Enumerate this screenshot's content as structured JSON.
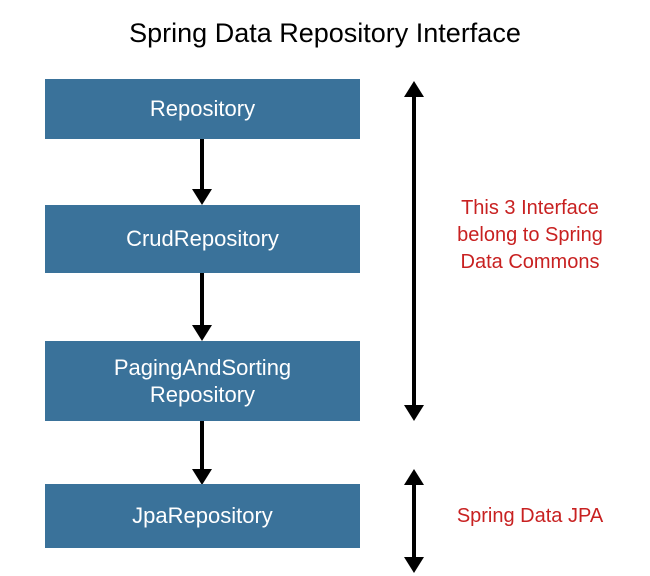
{
  "title": "Spring Data Repository Interface",
  "boxes": {
    "b1": "Repository",
    "b2": "CrudRepository",
    "b3": "PagingAndSorting\nRepository",
    "b4": "JpaRepository"
  },
  "notes": {
    "commons": "This 3 Interface belong to Spring Data Commons",
    "jpa": "Spring Data JPA"
  },
  "colors": {
    "box_fill": "#3a729a",
    "note_text": "#c82121"
  }
}
